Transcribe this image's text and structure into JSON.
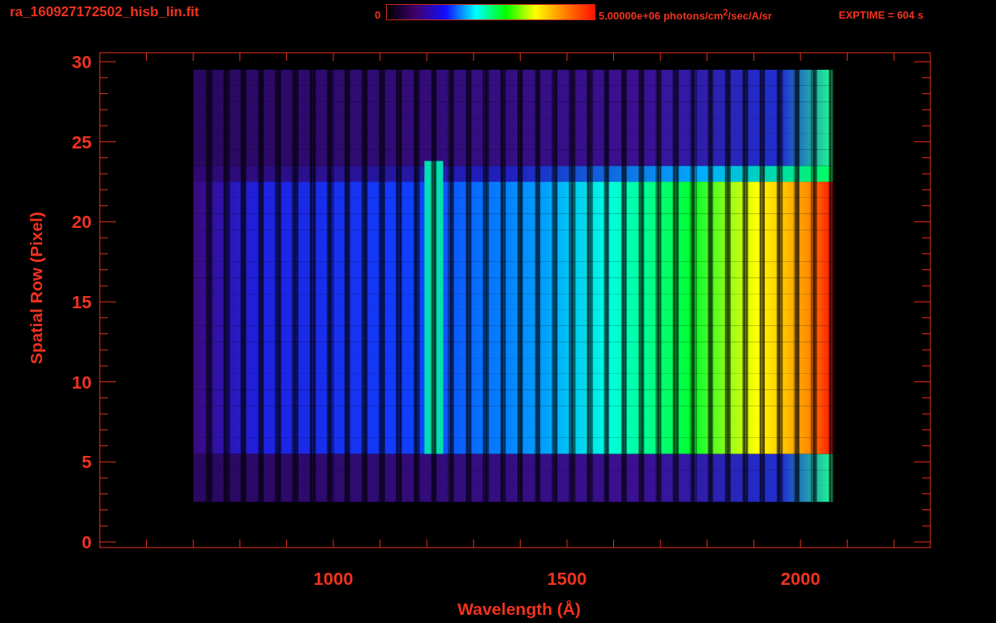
{
  "header": {
    "file_title": "ra_160927172502_hisb_lin.fit",
    "colorbar": {
      "min_label": "0",
      "max_label": "5.00000e+06 photons/cm$^{2}$/sec/A/sr"
    },
    "exposure": "EXPTIME = 604 s"
  },
  "plot": {
    "x_axis": {
      "title": "Wavelength (Å)",
      "tick_labels": [
        "1000",
        "1500",
        "2000"
      ]
    },
    "y_axis": {
      "title": "Spatial Row (Pixel)",
      "tick_labels": [
        "30",
        "25",
        "20",
        "15",
        "10",
        "5",
        "0"
      ]
    }
  }
}
